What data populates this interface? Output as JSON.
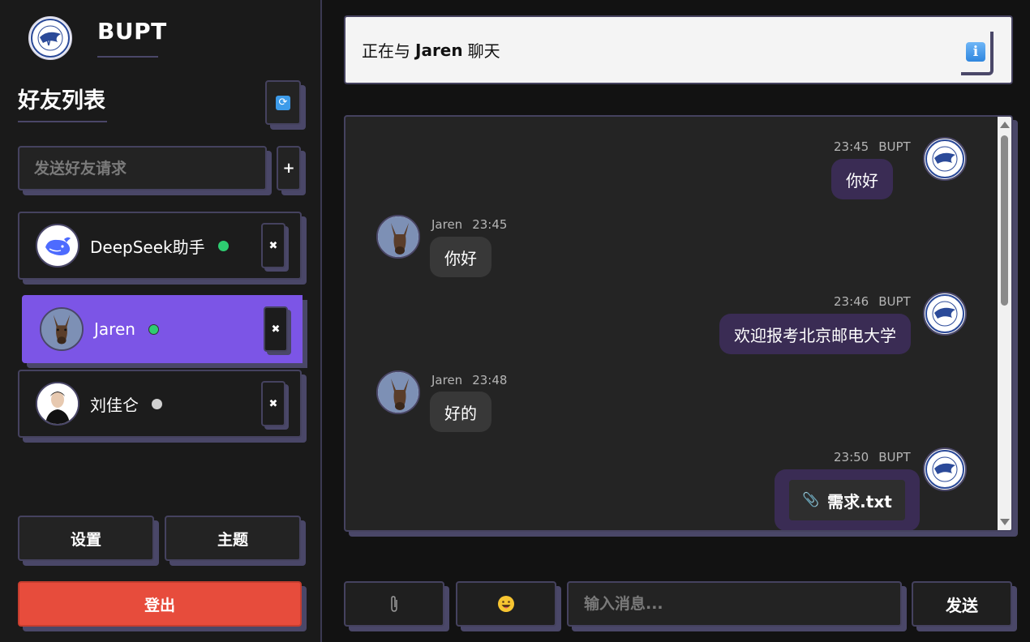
{
  "app": {
    "brand": "BUPT"
  },
  "sidebar": {
    "title": "好友列表",
    "friend_request_placeholder": "发送好友请求",
    "add_label": "+",
    "friends": [
      {
        "name": "DeepSeek助手",
        "status": "online",
        "status_color": "#2ecc71"
      },
      {
        "name": "Jaren",
        "status": "online",
        "status_color": "#2ecc71",
        "active": true
      },
      {
        "name": "刘佳仑",
        "status": "offline",
        "status_color": "#d0d0d0"
      }
    ],
    "remove_label": "✖",
    "settings_label": "设置",
    "theme_label": "主题",
    "logout_label": "登出"
  },
  "chat": {
    "header_prefix": "正在与",
    "header_name": "Jaren",
    "header_suffix": "聊天",
    "messages": [
      {
        "direction": "out",
        "time": "23:45",
        "sender": "BUPT",
        "text": "你好"
      },
      {
        "direction": "in",
        "sender": "Jaren",
        "time": "23:45",
        "text": "你好"
      },
      {
        "direction": "out",
        "time": "23:46",
        "sender": "BUPT",
        "text": "欢迎报考北京邮电大学"
      },
      {
        "direction": "in",
        "sender": "Jaren",
        "time": "23:48",
        "text": "好的"
      },
      {
        "direction": "out",
        "time": "23:50",
        "sender": "BUPT",
        "file_name": "需求.txt"
      }
    ]
  },
  "composer": {
    "attach_icon": "paperclip-icon",
    "emoji_icon": "emoji-icon",
    "placeholder": "输入消息...",
    "send_label": "发送"
  },
  "colors": {
    "accent": "#7c55e6",
    "logout": "#e74c3c",
    "online": "#2ecc71",
    "offline": "#d0d0d0",
    "out_bubble": "#3a2c54",
    "in_bubble": "#383838"
  }
}
